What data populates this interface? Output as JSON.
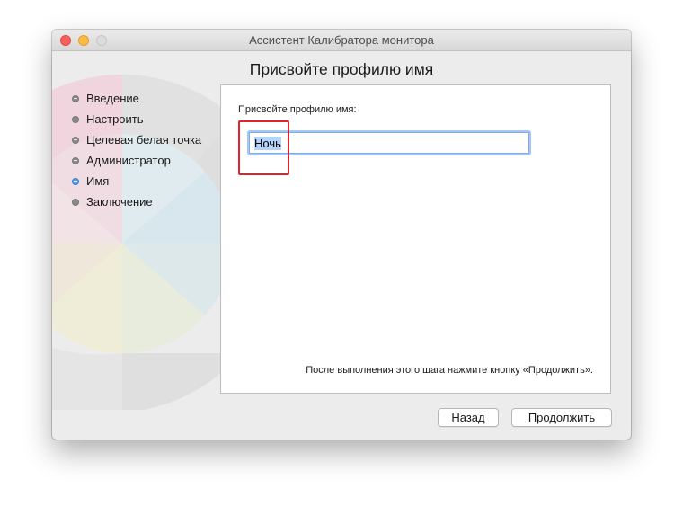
{
  "window": {
    "title": "Ассистент Калибратора монитора"
  },
  "page": {
    "heading": "Присвойте профилю имя"
  },
  "steps": [
    {
      "label": "Введение",
      "state": "done"
    },
    {
      "label": "Настроить",
      "state": "pending"
    },
    {
      "label": "Целевая белая точка",
      "state": "done"
    },
    {
      "label": "Администратор",
      "state": "done"
    },
    {
      "label": "Имя",
      "state": "current"
    },
    {
      "label": "Заключение",
      "state": "pending"
    }
  ],
  "form": {
    "label": "Присвойте профилю имя:",
    "name_value": "Ночь",
    "hint": "После выполнения этого шага нажмите кнопку «Продолжить»."
  },
  "buttons": {
    "back": "Назад",
    "continue": "Продолжить"
  },
  "colors": {
    "highlight_box": "#e0242a",
    "focus_ring": "#7cabe8"
  }
}
